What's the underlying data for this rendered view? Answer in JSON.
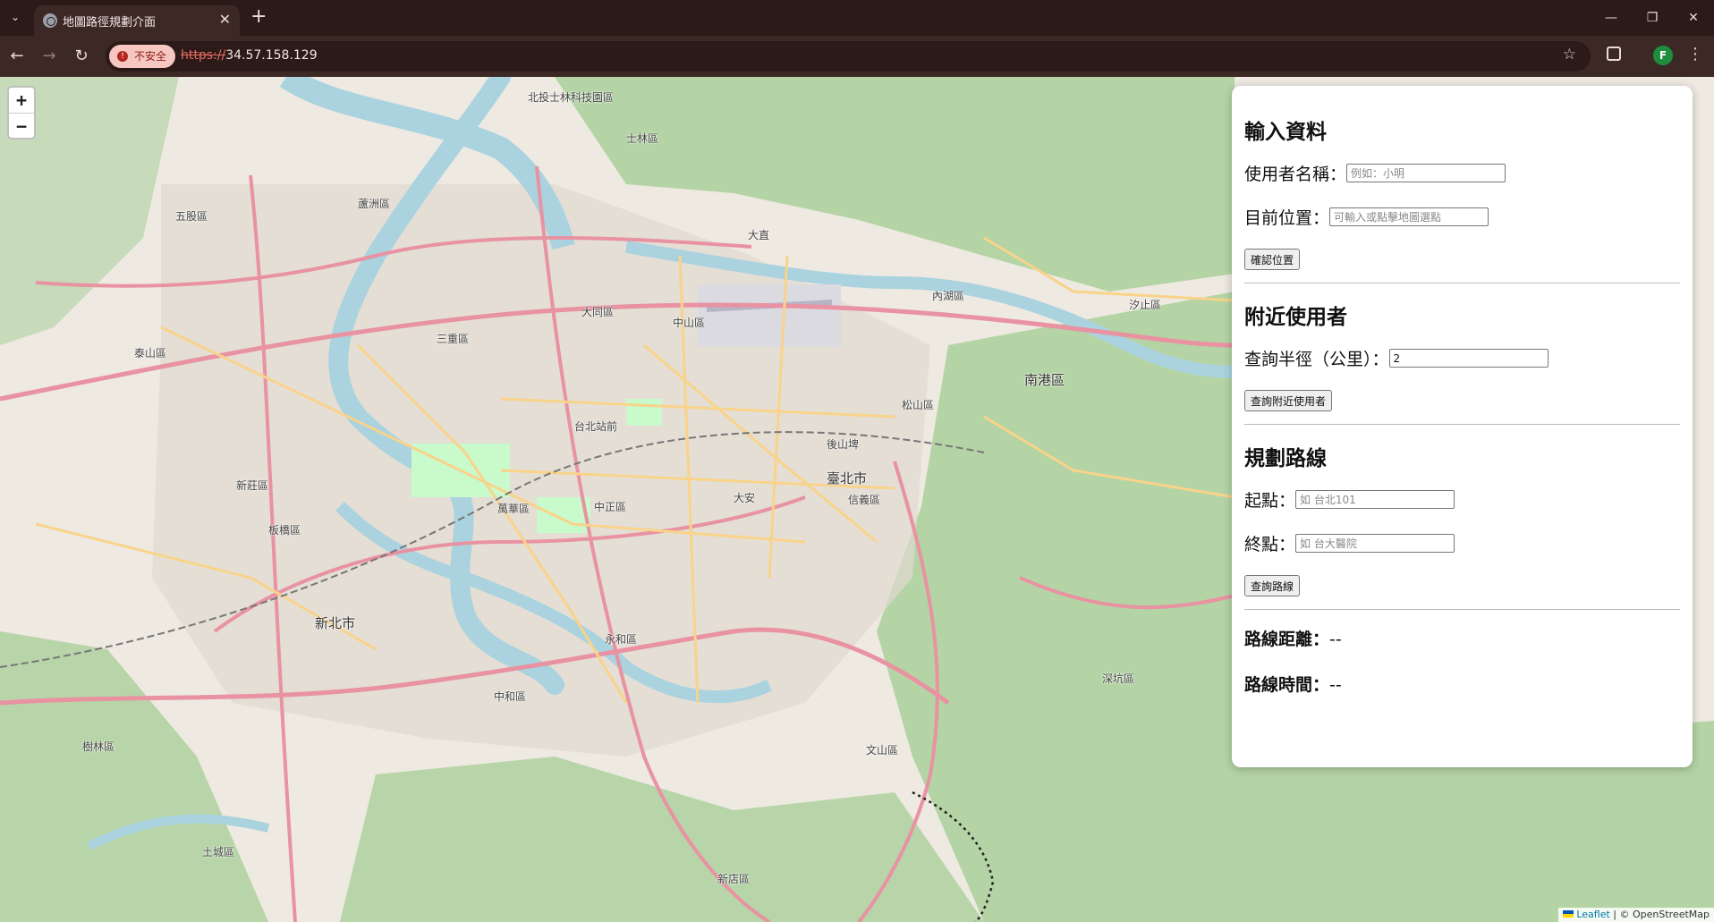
{
  "browser": {
    "tab_title": "地圖路徑規劃介面",
    "security_label": "不安全",
    "url_scheme": "https://",
    "url_host": "34.57.158.129",
    "profile_initial": "F"
  },
  "map": {
    "zoom_in_label": "+",
    "zoom_out_label": "−",
    "attribution_leaflet": "Leaflet",
    "attribution_separator": " | © OpenStreetMap",
    "labels": [
      "北投士林科技園區",
      "士林區",
      "蘆洲區",
      "五股區",
      "大同區",
      "中山區",
      "大直",
      "內湖區",
      "南港區",
      "松山區",
      "信義區",
      "臺北市",
      "大安",
      "中正區",
      "萬華區",
      "新莊區",
      "三重區",
      "新北市",
      "永和區",
      "中和區",
      "板橋區",
      "樹林區",
      "土城區",
      "文山區",
      "新店區",
      "深坑區",
      "汐止區",
      "泰山區",
      "台北站前",
      "後山埤"
    ]
  },
  "panel": {
    "section_input": {
      "title": "輸入資料",
      "username_label": "使用者名稱：",
      "username_placeholder": "例如：小明",
      "location_label": "目前位置：",
      "location_placeholder": "可輸入或點擊地圖選點",
      "confirm_button": "確認位置"
    },
    "section_nearby": {
      "title": "附近使用者",
      "radius_label": "查詢半徑（公里）：",
      "radius_value": "2",
      "query_button": "查詢附近使用者"
    },
    "section_route": {
      "title": "規劃路線",
      "start_label": "起點：",
      "start_placeholder": "如 台北101",
      "end_label": "終點：",
      "end_placeholder": "如 台大醫院",
      "route_button": "查詢路線"
    },
    "results": {
      "distance_label": "路線距離：",
      "distance_value": "--",
      "time_label": "路線時間：",
      "time_value": "--"
    }
  },
  "colors": {
    "tabbar": "#2b1a18",
    "toolbar": "#3c2926",
    "map_base": "#eee9e1",
    "river": "#aad3df",
    "forest": "#add19e",
    "primary_road": "#e892a2",
    "secondary_road": "#f9d38a"
  }
}
